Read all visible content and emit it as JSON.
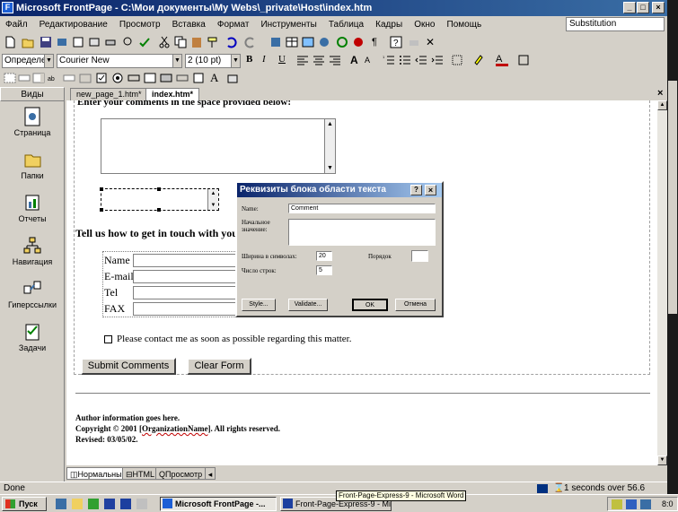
{
  "window": {
    "title": "Microsoft FrontPage - C:\\Мои документы\\My Webs\\_private\\Host\\index.htm",
    "minimize": "_",
    "maximize": "□",
    "close": "×"
  },
  "menu": {
    "items": [
      "Файл",
      "Редактирование",
      "Просмотр",
      "Вставка",
      "Формат",
      "Инструменты",
      "Таблица",
      "Кадры",
      "Окно",
      "Помощь"
    ],
    "substitution": "Substitution"
  },
  "format_toolbar": {
    "style": "Определени",
    "font": "Courier New",
    "size": "2 (10 pt)"
  },
  "views": {
    "title": "Виды",
    "items": [
      "Страница",
      "Папки",
      "Отчеты",
      "Навигация",
      "Гиперссылки",
      "Задачи"
    ]
  },
  "tabs": [
    "new_page_1.htm*",
    "index.htm*"
  ],
  "page": {
    "intro": "Enter your comments in the space provided below:",
    "contact_heading": "Tell us how to get in touch with you:",
    "fields": [
      "Name",
      "E-mail",
      "Tel",
      "FAX"
    ],
    "checkbox_label": "Please contact me as soon as possible regarding this matter.",
    "submit": "Submit Comments",
    "clear": "Clear Form",
    "author": "Author information goes here.",
    "copyright_prefix": "Copyright © 2001 [",
    "org": "OrganizationName",
    "copyright_suffix": "]. All rights reserved.",
    "revised": "Revised: 03/05/02."
  },
  "dialog": {
    "title": "Реквизиты блока области текста",
    "help": "?",
    "close": "×",
    "name_label": "Name:",
    "name_value": "Comment",
    "initial_label": "Начальное значение:",
    "width_label": "Ширина в символах:",
    "width_value": "20",
    "order_label": "Порядок",
    "rows_label": "Число строк:",
    "rows_value": "5",
    "style_btn": "Style...",
    "validate_btn": "Validate...",
    "ok_btn": "OK",
    "cancel_btn": "Отмена"
  },
  "view_tabs": [
    "Нормальный",
    "HTML",
    "Просмотр"
  ],
  "status": {
    "left": "Done",
    "right": "1 seconds over 56.6"
  },
  "taskbar": {
    "start": "Пуск",
    "tasks": [
      "Microsoft FrontPage -...",
      "Front-Page-Express-9 - Mic..."
    ],
    "tooltip": "Front-Page-Express-9 - Microsoft Word",
    "clock": "8:0"
  }
}
